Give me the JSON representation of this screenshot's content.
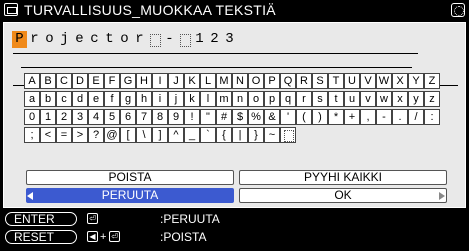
{
  "title": "TURVALLISUUS_MUOKKAA TEKSTIÄ",
  "text_chars": [
    "P",
    "r",
    "o",
    "j",
    "e",
    "c",
    "t",
    "o",
    "r",
    " ",
    "-",
    " ",
    "1",
    "2",
    "3"
  ],
  "keyboard_rows": [
    [
      "A",
      "B",
      "C",
      "D",
      "E",
      "F",
      "G",
      "H",
      "I",
      "J",
      "K",
      "L",
      "M",
      "N",
      "O",
      "P",
      "Q",
      "R",
      "S",
      "T",
      "U",
      "V",
      "W",
      "X",
      "Y",
      "Z"
    ],
    [
      "a",
      "b",
      "c",
      "d",
      "e",
      "f",
      "g",
      "h",
      "i",
      "j",
      "k",
      "l",
      "m",
      "n",
      "o",
      "p",
      "q",
      "r",
      "s",
      "t",
      "u",
      "v",
      "w",
      "x",
      "y",
      "z"
    ],
    [
      "0",
      "1",
      "2",
      "3",
      "4",
      "5",
      "6",
      "7",
      "8",
      "9",
      "!",
      "\"",
      "#",
      "$",
      "%",
      "&",
      "'",
      "(",
      ")",
      "*",
      "+",
      ",",
      "-",
      ".",
      "/",
      ":"
    ],
    [
      ";",
      "<",
      "=",
      ">",
      "?",
      "@",
      "[",
      "\\",
      "]",
      "^",
      "_",
      "`",
      "{",
      "|",
      "}",
      "~",
      " "
    ]
  ],
  "buttons": {
    "poista": "POISTA",
    "pyyhi_kaikki": "PYYHI KAIKKI",
    "peruuta": "PERUUTA",
    "ok": "OK"
  },
  "legend": {
    "enter_label": "ENTER",
    "reset_label": "RESET",
    "enter_action": ":PERUUTA",
    "reset_action": ":POISTA",
    "plus": "+"
  },
  "colors": {
    "cursor": "#f08a1a",
    "selected_button": "#3c5ad0",
    "panel": "#e9e9e9"
  }
}
